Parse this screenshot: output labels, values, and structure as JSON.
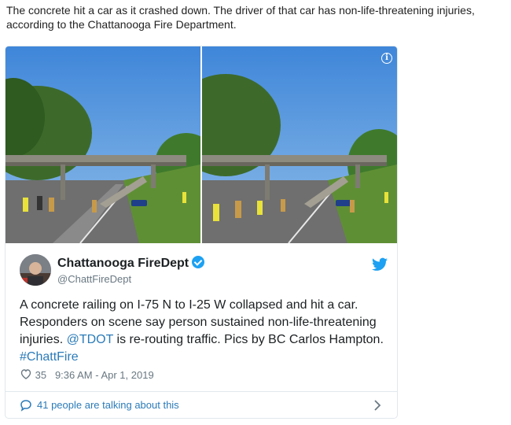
{
  "article": {
    "text": "The concrete hit a car as it crashed down. The driver of that car has non-life-threatening injuries, according to the Chattanooga Fire Department."
  },
  "tweet": {
    "author_name": "Chattanooga FireDept",
    "author_handle": "@ChattFireDept",
    "body_part1": "A concrete railing on I-75 N to I-25 W collapsed and hit a car. Responders on scene say person sustained non-life-threatening injuries. ",
    "mention": "@TDOT",
    "body_part2": " is re-routing traffic. Pics by BC Carlos Hampton. ",
    "hashtag": "#ChattFire",
    "like_count": "35",
    "timestamp": "9:36 AM - Apr 1, 2019",
    "talking_text": "41 people are talking about this"
  },
  "icons": {
    "info": "info-icon",
    "verified": "verified-badge-icon",
    "twitter": "twitter-bird-icon",
    "heart": "heart-icon",
    "comment": "comment-bubble-icon",
    "chevron": "chevron-right-icon"
  },
  "colors": {
    "link": "#2b7bb9",
    "twitter_blue": "#1da1f2",
    "meta_gray": "#697882"
  }
}
